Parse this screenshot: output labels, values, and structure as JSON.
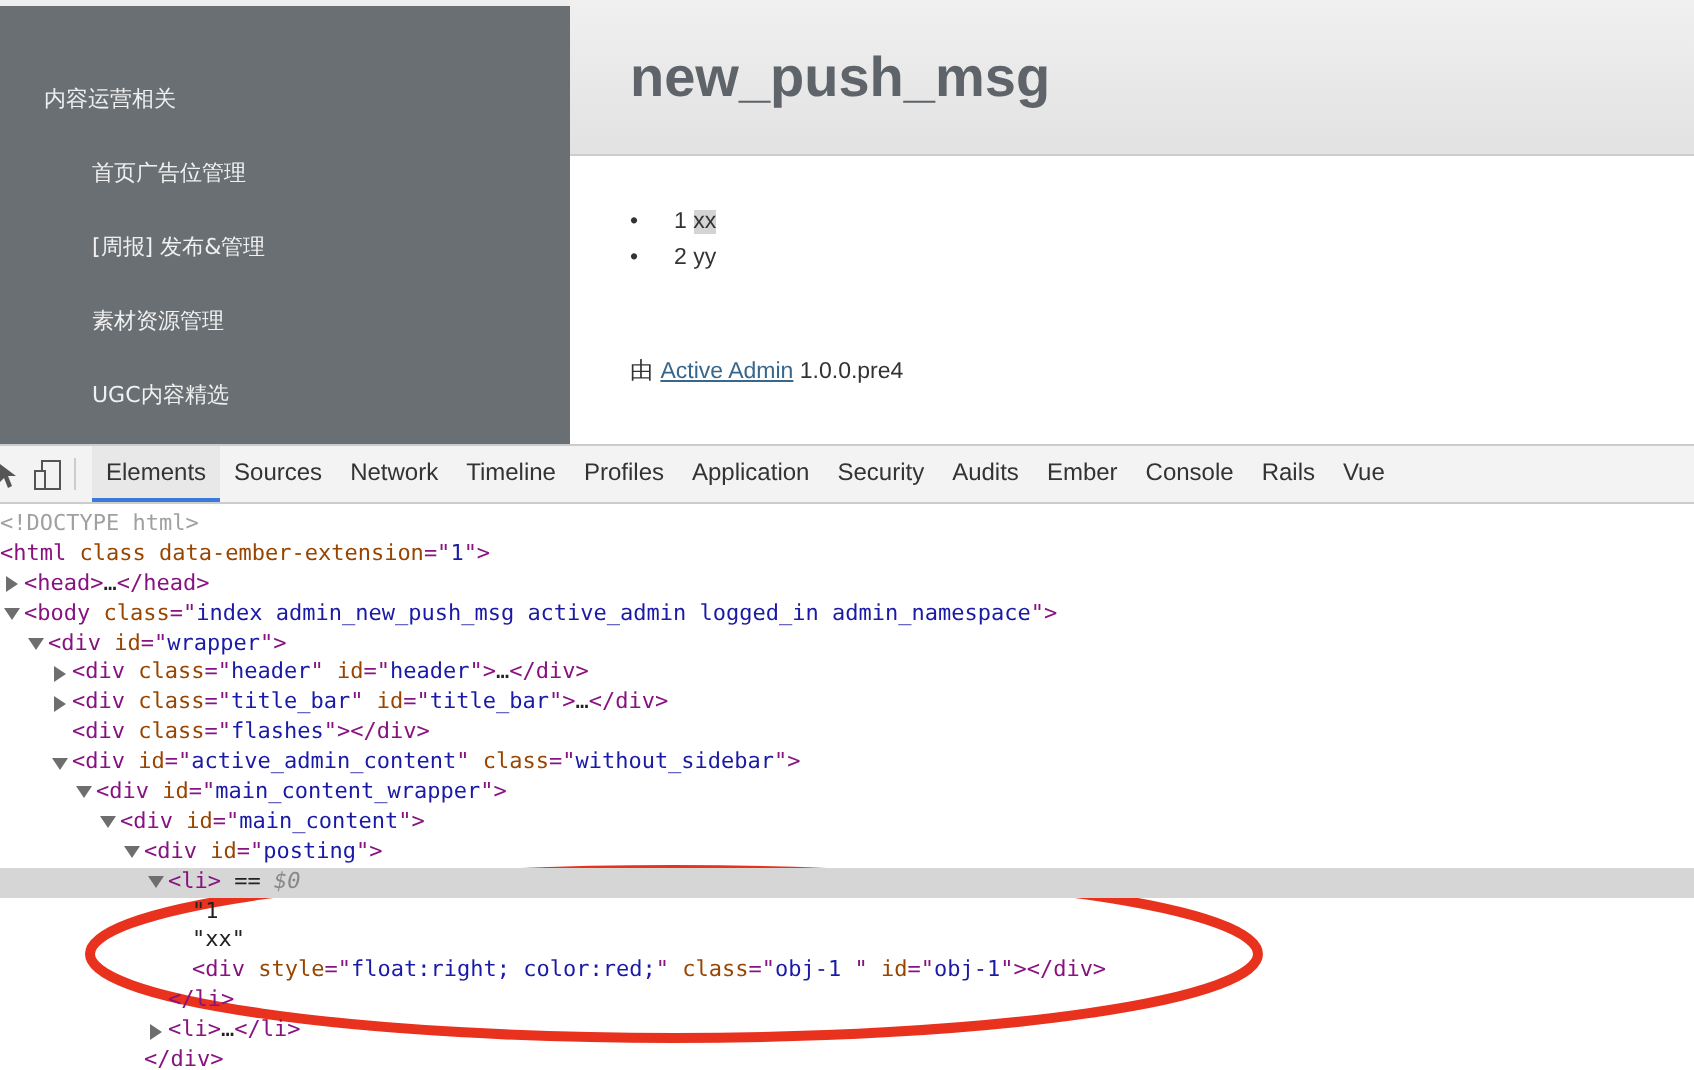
{
  "sidebar": {
    "section": "内容运营相关",
    "items": [
      {
        "label": "首页广告位管理"
      },
      {
        "label": "[周报] 发布&管理"
      },
      {
        "label": "素材资源管理"
      },
      {
        "label": "UGC内容精选"
      }
    ]
  },
  "page": {
    "title": "new_push_msg",
    "list": [
      {
        "marker": "•",
        "number": "1",
        "text": "xx",
        "highlighted": true
      },
      {
        "marker": "•",
        "number": "2",
        "text": "yy",
        "highlighted": false
      }
    ],
    "footer": {
      "prefix": "由",
      "link": "Active Admin",
      "version": "1.0.0.pre4"
    }
  },
  "devtools": {
    "tabs": [
      {
        "label": "Elements",
        "selected": true
      },
      {
        "label": "Sources",
        "selected": false
      },
      {
        "label": "Network",
        "selected": false
      },
      {
        "label": "Timeline",
        "selected": false
      },
      {
        "label": "Profiles",
        "selected": false
      },
      {
        "label": "Application",
        "selected": false
      },
      {
        "label": "Security",
        "selected": false
      },
      {
        "label": "Audits",
        "selected": false
      },
      {
        "label": "Ember",
        "selected": false
      },
      {
        "label": "Console",
        "selected": false
      },
      {
        "label": "Rails",
        "selected": false
      },
      {
        "label": "Vue",
        "selected": false
      }
    ],
    "dom": [
      {
        "segments": [
          {
            "kind": "comment",
            "text": "<!DOCTYPE html>"
          }
        ]
      },
      {
        "segments": [
          {
            "kind": "tag",
            "text": "<html"
          },
          {
            "kind": "attr",
            "text": " class data-ember-extension"
          },
          {
            "kind": "tag",
            "text": "=\""
          },
          {
            "kind": "value",
            "text": "1"
          },
          {
            "kind": "tag",
            "text": "\">"
          }
        ],
        "children": [
          {
            "expanded": false,
            "selected": false,
            "segments": [
              {
                "kind": "tag",
                "text": "<head>"
              },
              {
                "kind": "text",
                "text": "…"
              },
              {
                "kind": "tag",
                "text": "</head>"
              }
            ]
          },
          {
            "expanded": true,
            "selected": false,
            "segments": [
              {
                "kind": "tag",
                "text": "<body"
              },
              {
                "kind": "attr",
                "text": " class"
              },
              {
                "kind": "tag",
                "text": "=\""
              },
              {
                "kind": "value",
                "text": "index admin_new_push_msg active_admin logged_in admin_namespace"
              },
              {
                "kind": "tag",
                "text": "\">"
              }
            ],
            "children": [
              {
                "expanded": true,
                "selected": false,
                "segments": [
                  {
                    "kind": "tag",
                    "text": "<div"
                  },
                  {
                    "kind": "attr",
                    "text": " id"
                  },
                  {
                    "kind": "tag",
                    "text": "=\""
                  },
                  {
                    "kind": "value",
                    "text": "wrapper"
                  },
                  {
                    "kind": "tag",
                    "text": "\">"
                  }
                ],
                "children": [
                  {
                    "expanded": false,
                    "selected": false,
                    "segments": [
                      {
                        "kind": "tag",
                        "text": "<div"
                      },
                      {
                        "kind": "attr",
                        "text": " class"
                      },
                      {
                        "kind": "tag",
                        "text": "=\""
                      },
                      {
                        "kind": "value",
                        "text": "header"
                      },
                      {
                        "kind": "tag",
                        "text": "\""
                      },
                      {
                        "kind": "attr",
                        "text": " id"
                      },
                      {
                        "kind": "tag",
                        "text": "=\""
                      },
                      {
                        "kind": "value",
                        "text": "header"
                      },
                      {
                        "kind": "tag",
                        "text": "\">"
                      },
                      {
                        "kind": "text",
                        "text": "…"
                      },
                      {
                        "kind": "tag",
                        "text": "</div>"
                      }
                    ]
                  },
                  {
                    "expanded": false,
                    "selected": false,
                    "segments": [
                      {
                        "kind": "tag",
                        "text": "<div"
                      },
                      {
                        "kind": "attr",
                        "text": " class"
                      },
                      {
                        "kind": "tag",
                        "text": "=\""
                      },
                      {
                        "kind": "value",
                        "text": "title_bar"
                      },
                      {
                        "kind": "tag",
                        "text": "\""
                      },
                      {
                        "kind": "attr",
                        "text": " id"
                      },
                      {
                        "kind": "tag",
                        "text": "=\""
                      },
                      {
                        "kind": "value",
                        "text": "title_bar"
                      },
                      {
                        "kind": "tag",
                        "text": "\">"
                      },
                      {
                        "kind": "text",
                        "text": "…"
                      },
                      {
                        "kind": "tag",
                        "text": "</div>"
                      }
                    ]
                  },
                  {
                    "segments": [
                      {
                        "kind": "tag",
                        "text": "<div"
                      },
                      {
                        "kind": "attr",
                        "text": " class"
                      },
                      {
                        "kind": "tag",
                        "text": "=\""
                      },
                      {
                        "kind": "value",
                        "text": "flashes"
                      },
                      {
                        "kind": "tag",
                        "text": "\"></div>"
                      }
                    ]
                  },
                  {
                    "expanded": true,
                    "selected": false,
                    "segments": [
                      {
                        "kind": "tag",
                        "text": "<div"
                      },
                      {
                        "kind": "attr",
                        "text": " id"
                      },
                      {
                        "kind": "tag",
                        "text": "=\""
                      },
                      {
                        "kind": "value",
                        "text": "active_admin_content"
                      },
                      {
                        "kind": "tag",
                        "text": "\""
                      },
                      {
                        "kind": "attr",
                        "text": " class"
                      },
                      {
                        "kind": "tag",
                        "text": "=\""
                      },
                      {
                        "kind": "value",
                        "text": "without_sidebar"
                      },
                      {
                        "kind": "tag",
                        "text": "\">"
                      }
                    ],
                    "children": [
                      {
                        "expanded": true,
                        "selected": false,
                        "segments": [
                          {
                            "kind": "tag",
                            "text": "<div"
                          },
                          {
                            "kind": "attr",
                            "text": " id"
                          },
                          {
                            "kind": "tag",
                            "text": "=\""
                          },
                          {
                            "kind": "value",
                            "text": "main_content_wrapper"
                          },
                          {
                            "kind": "tag",
                            "text": "\">"
                          }
                        ],
                        "children": [
                          {
                            "expanded": true,
                            "selected": false,
                            "segments": [
                              {
                                "kind": "tag",
                                "text": "<div"
                              },
                              {
                                "kind": "attr",
                                "text": " id"
                              },
                              {
                                "kind": "tag",
                                "text": "=\""
                              },
                              {
                                "kind": "value",
                                "text": "main_content"
                              },
                              {
                                "kind": "tag",
                                "text": "\">"
                              }
                            ],
                            "children": [
                              {
                                "expanded": true,
                                "selected": false,
                                "segments": [
                                  {
                                    "kind": "tag",
                                    "text": "<div"
                                  },
                                  {
                                    "kind": "attr",
                                    "text": " id"
                                  },
                                  {
                                    "kind": "tag",
                                    "text": "=\""
                                  },
                                  {
                                    "kind": "value",
                                    "text": "posting"
                                  },
                                  {
                                    "kind": "tag",
                                    "text": "\">"
                                  }
                                ],
                                "closing": [
                                  {
                                    "kind": "tag",
                                    "text": "</div>"
                                  }
                                ],
                                "children": [
                                  {
                                    "expanded": true,
                                    "selected": true,
                                    "segments": [
                                      {
                                        "kind": "tag",
                                        "text": "<li>"
                                      },
                                      {
                                        "kind": "text",
                                        "text": " == "
                                      },
                                      {
                                        "kind": "dollar",
                                        "text": "$0"
                                      }
                                    ],
                                    "closing": [
                                      {
                                        "kind": "tag",
                                        "text": "</li>"
                                      }
                                    ],
                                    "children": [
                                      {
                                        "segments": [
                                          {
                                            "kind": "text",
                                            "text": "\"1"
                                          }
                                        ]
                                      },
                                      {
                                        "segments": [
                                          {
                                            "kind": "text",
                                            "text": "\"xx\""
                                          }
                                        ]
                                      },
                                      {
                                        "segments": [
                                          {
                                            "kind": "tag",
                                            "text": "<div"
                                          },
                                          {
                                            "kind": "attr",
                                            "text": " style"
                                          },
                                          {
                                            "kind": "tag",
                                            "text": "=\""
                                          },
                                          {
                                            "kind": "value",
                                            "text": "float:right; color:red;"
                                          },
                                          {
                                            "kind": "tag",
                                            "text": "\""
                                          },
                                          {
                                            "kind": "attr",
                                            "text": " class"
                                          },
                                          {
                                            "kind": "tag",
                                            "text": "=\""
                                          },
                                          {
                                            "kind": "value",
                                            "text": "obj-1 "
                                          },
                                          {
                                            "kind": "tag",
                                            "text": "\""
                                          },
                                          {
                                            "kind": "attr",
                                            "text": " id"
                                          },
                                          {
                                            "kind": "tag",
                                            "text": "=\""
                                          },
                                          {
                                            "kind": "value",
                                            "text": "obj-1"
                                          },
                                          {
                                            "kind": "tag",
                                            "text": "\"></div>"
                                          }
                                        ]
                                      }
                                    ]
                                  },
                                  {
                                    "expanded": false,
                                    "selected": false,
                                    "segments": [
                                      {
                                        "kind": "tag",
                                        "text": "<li>"
                                      },
                                      {
                                        "kind": "text",
                                        "text": "…"
                                      },
                                      {
                                        "kind": "tag",
                                        "text": "</li>"
                                      }
                                    ]
                                  }
                                ]
                              }
                            ]
                          }
                        ]
                      }
                    ]
                  }
                ]
              }
            ]
          }
        ]
      }
    ]
  }
}
